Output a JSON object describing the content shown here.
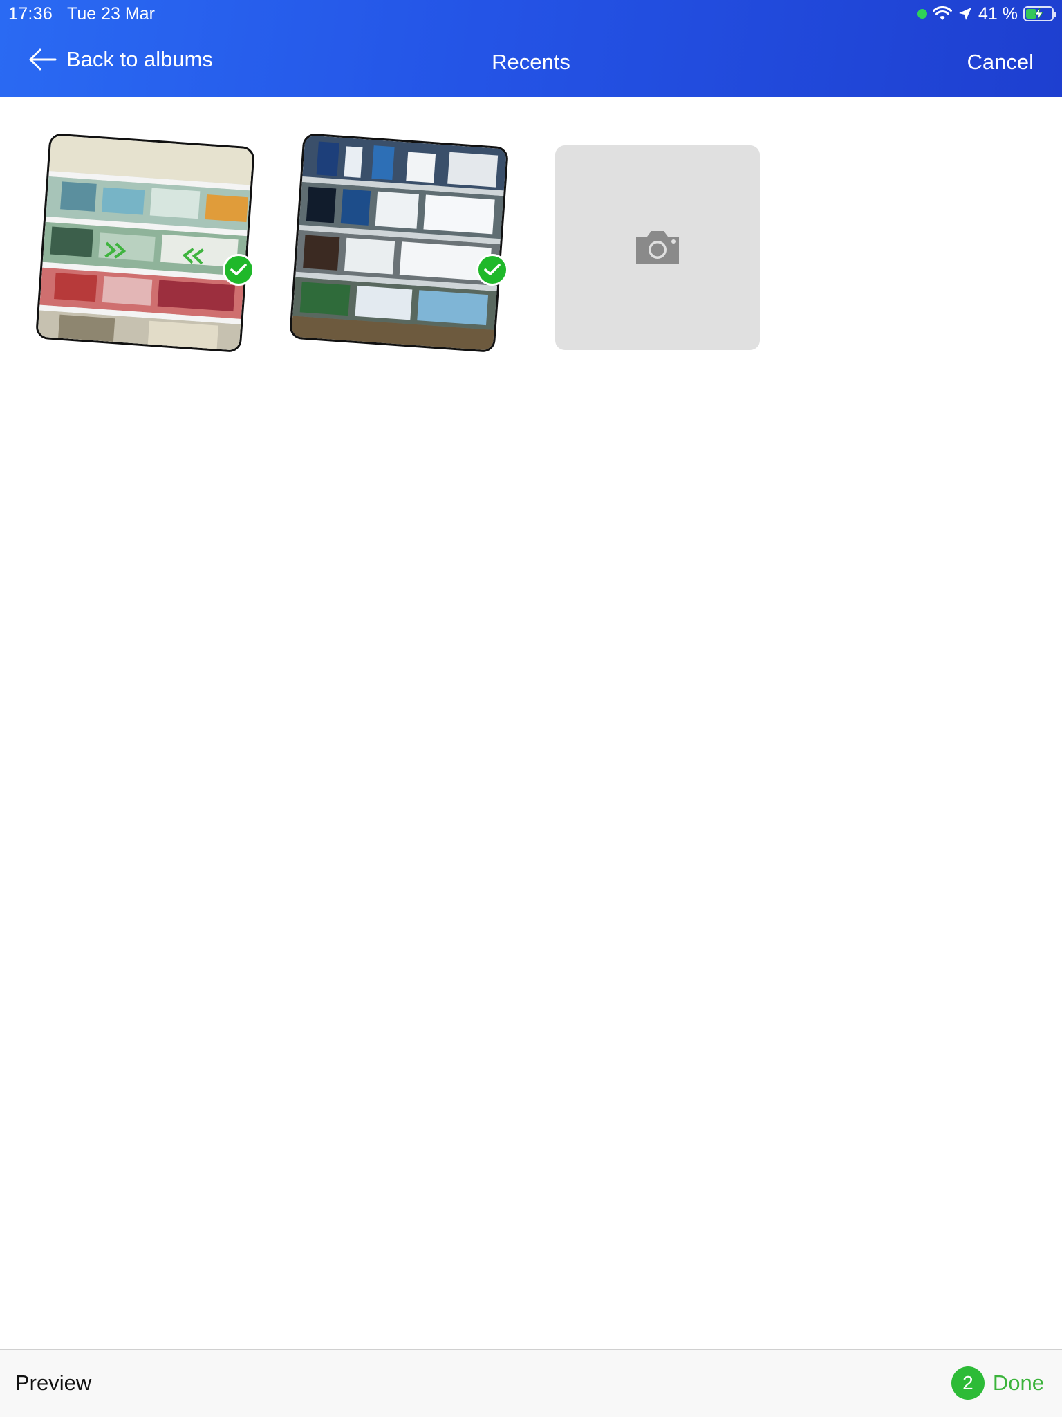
{
  "status_bar": {
    "time": "17:36",
    "date": "Tue 23 Mar",
    "battery_percent": "41 %",
    "battery_level": 0.41,
    "icons": [
      "green-dot-indicator",
      "wifi-icon",
      "location-arrow-icon",
      "battery-charging-icon"
    ]
  },
  "header": {
    "back_label": "Back to albums",
    "title": "Recents",
    "cancel_label": "Cancel"
  },
  "photos": [
    {
      "kind": "photo",
      "subject": "supermarket dairy shelf",
      "selected": true
    },
    {
      "kind": "photo",
      "subject": "pharmacy cosmetics shelf",
      "selected": true
    },
    {
      "kind": "camera",
      "icon": "camera-icon"
    }
  ],
  "footer": {
    "preview_label": "Preview",
    "selected_count": "2",
    "done_label": "Done"
  },
  "colors": {
    "header_gradient_start": "#2a6af3",
    "header_gradient_end": "#1e3fd0",
    "selection_green": "#1fb82a",
    "done_green": "#3bb33b"
  }
}
